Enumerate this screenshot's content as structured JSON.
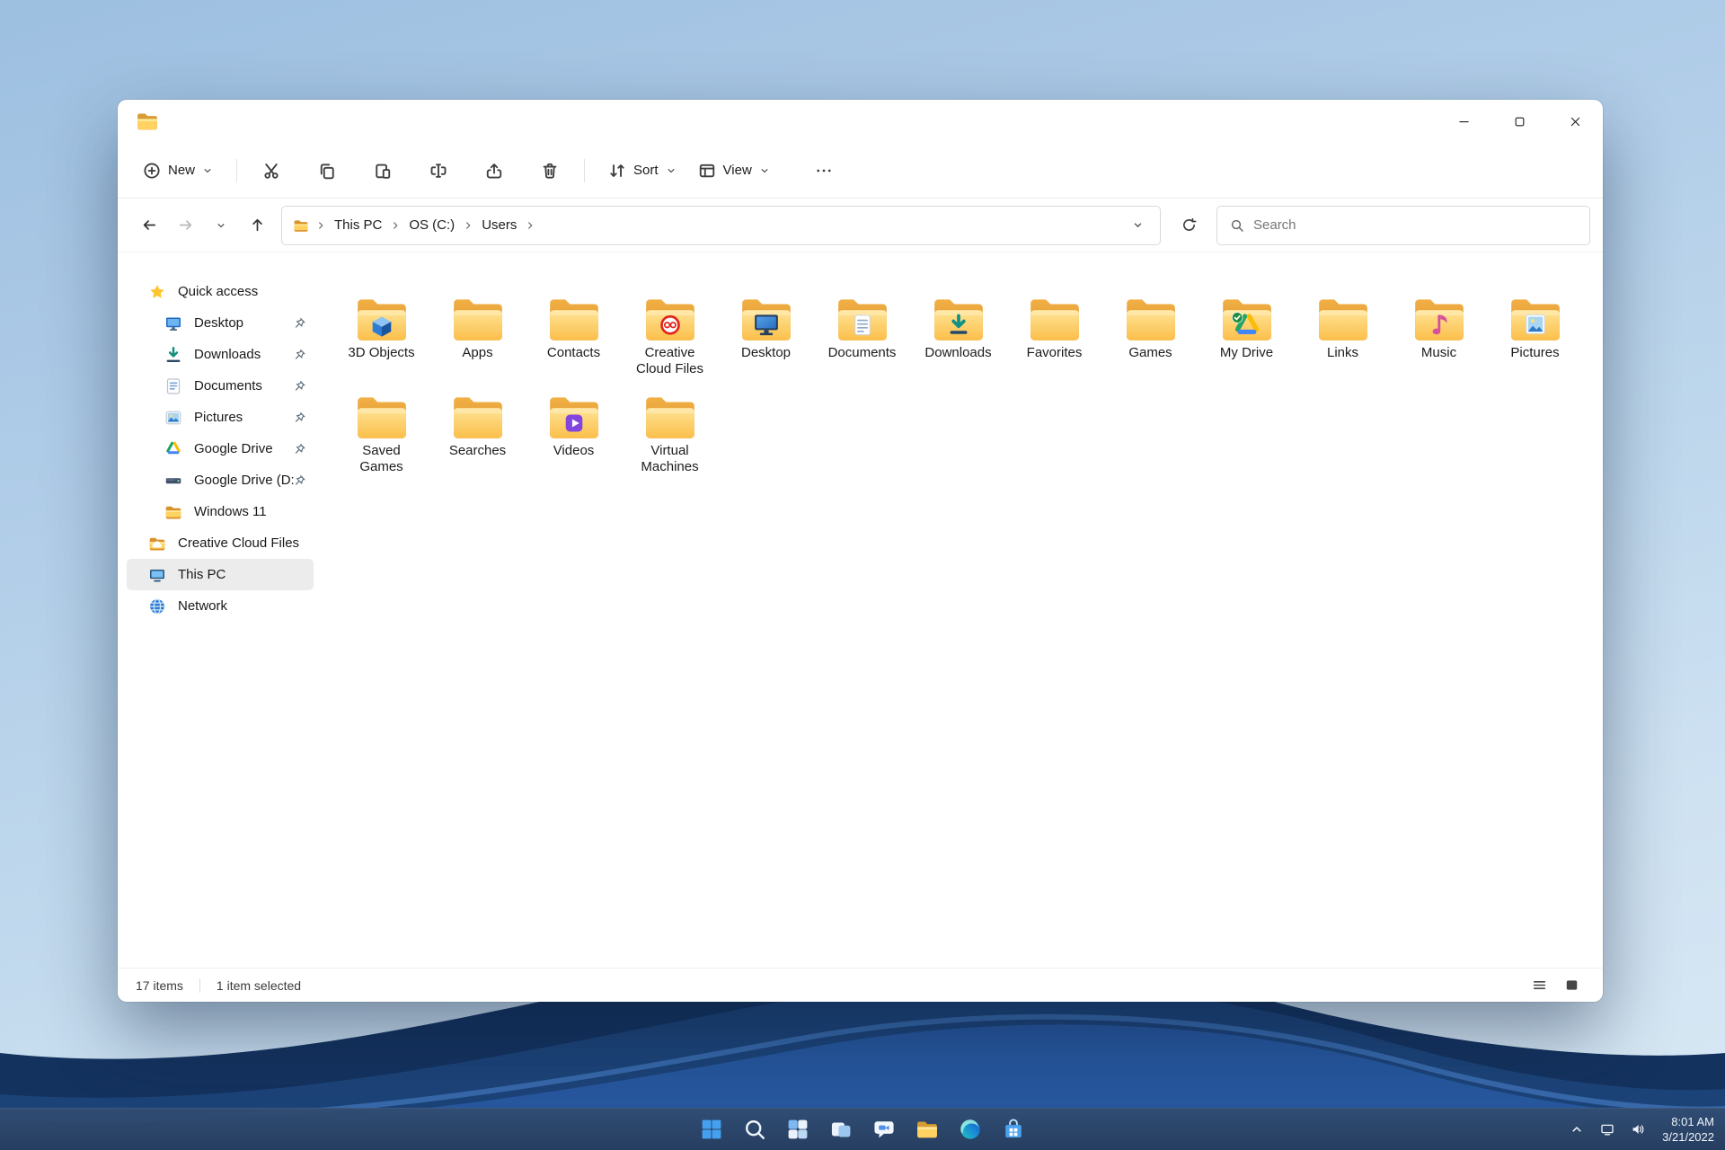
{
  "window": {
    "titlebar": {
      "app_icon": "file-explorer-icon",
      "controls": [
        "minimize-icon",
        "maximize-icon",
        "close-icon"
      ]
    },
    "toolbar": {
      "new_label": "New",
      "new_icon": "new-plus-icon",
      "action_icons": [
        "cut-icon",
        "copy-icon",
        "paste-icon",
        "rename-icon",
        "share-icon",
        "delete-icon"
      ],
      "sort_label": "Sort",
      "sort_icon": "sort-icon",
      "view_label": "View",
      "view_icon": "view-icon",
      "more_icon": "ellipsis-icon"
    },
    "address": {
      "nav_icons": [
        "back-icon",
        "forward-icon",
        "history-chevron-icon",
        "up-icon"
      ],
      "breadcrumb": [
        "This PC",
        "OS (C:)",
        "Users"
      ],
      "breadcrumb_folder_icon": "folder-icon",
      "dropdown_icon": "chevron-down-icon",
      "refresh_icon": "refresh-icon",
      "search_icon": "search-icon",
      "search_placeholder": "Search"
    },
    "sidebar": [
      {
        "label": "Quick access",
        "icon": "star-icon",
        "pinned": false,
        "indent": false,
        "selected": false
      },
      {
        "label": "Desktop",
        "icon": "monitor-icon",
        "pinned": true,
        "indent": true,
        "selected": false
      },
      {
        "label": "Downloads",
        "icon": "download-icon",
        "pinned": true,
        "indent": true,
        "selected": false
      },
      {
        "label": "Documents",
        "icon": "document-icon",
        "pinned": true,
        "indent": true,
        "selected": false
      },
      {
        "label": "Pictures",
        "icon": "picture-icon",
        "pinned": true,
        "indent": true,
        "selected": false
      },
      {
        "label": "Google Drive",
        "icon": "gdrive-icon",
        "pinned": true,
        "indent": true,
        "selected": false
      },
      {
        "label": "Google Drive (D:",
        "icon": "drive-icon",
        "pinned": true,
        "indent": true,
        "selected": false
      },
      {
        "label": "Windows 11",
        "icon": "folder-icon",
        "pinned": false,
        "indent": true,
        "selected": false
      },
      {
        "label": "Creative Cloud Files",
        "icon": "cc-folder-icon",
        "pinned": false,
        "indent": false,
        "selected": false
      },
      {
        "label": "This PC",
        "icon": "pc-icon",
        "pinned": false,
        "indent": false,
        "selected": true
      },
      {
        "label": "Network",
        "icon": "network-icon",
        "pinned": false,
        "indent": false,
        "selected": false
      }
    ],
    "folders": [
      {
        "label": "3D Objects",
        "overlay": "cube"
      },
      {
        "label": "Apps",
        "overlay": "none"
      },
      {
        "label": "Contacts",
        "overlay": "none"
      },
      {
        "label": "Creative Cloud Files",
        "overlay": "cc"
      },
      {
        "label": "Desktop",
        "overlay": "monitor"
      },
      {
        "label": "Documents",
        "overlay": "doc"
      },
      {
        "label": "Downloads",
        "overlay": "download"
      },
      {
        "label": "Favorites",
        "overlay": "none"
      },
      {
        "label": "Games",
        "overlay": "none"
      },
      {
        "label": "My Drive",
        "overlay": "gdrive"
      },
      {
        "label": "Links",
        "overlay": "none"
      },
      {
        "label": "Music",
        "overlay": "music"
      },
      {
        "label": "Pictures",
        "overlay": "picture"
      },
      {
        "label": "Saved Games",
        "overlay": "none"
      },
      {
        "label": "Searches",
        "overlay": "none"
      },
      {
        "label": "Videos",
        "overlay": "video"
      },
      {
        "label": "Virtual Machines",
        "overlay": "none"
      }
    ],
    "statusbar": {
      "items_count": "17 items",
      "selection": "1 item selected",
      "view_icons": [
        "list-view-icon",
        "thumb-view-icon"
      ]
    }
  },
  "taskbar": {
    "icons": [
      "start-icon",
      "taskbar-search-icon",
      "widgets-icon",
      "task-view-icon",
      "chat-icon",
      "file-explorer-icon",
      "edge-icon",
      "store-icon"
    ],
    "tray_icons": [
      "chevron-up-icon",
      "network-tray-icon",
      "volume-icon"
    ],
    "time": "8:01 AM",
    "date": "3/21/2022"
  },
  "colors": {
    "folder_front": "#fbbf4b",
    "folder_back": "#d9912b",
    "accent_blue": "#2f7cd3",
    "taskbar_bg": "#2c4a70"
  }
}
